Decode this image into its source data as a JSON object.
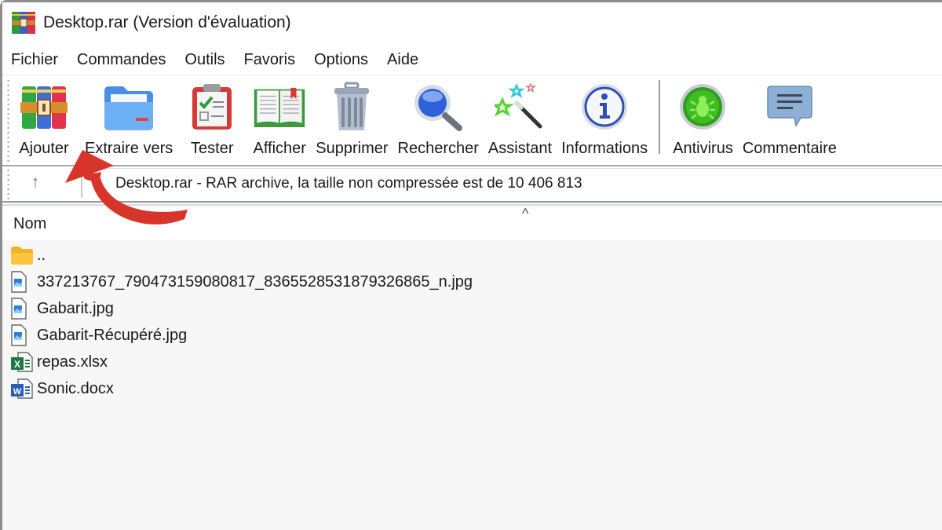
{
  "window": {
    "title": "Desktop.rar (Version d'évaluation)",
    "app_icon": "winrar-books-icon"
  },
  "menu": {
    "items": [
      {
        "label": "Fichier"
      },
      {
        "label": "Commandes"
      },
      {
        "label": "Outils"
      },
      {
        "label": "Favoris"
      },
      {
        "label": "Options"
      },
      {
        "label": "Aide"
      }
    ]
  },
  "toolbar": {
    "buttons": [
      {
        "label": "Ajouter",
        "icon": "add-archive-icon"
      },
      {
        "label": "Extraire vers",
        "icon": "extract-folder-icon"
      },
      {
        "label": "Tester",
        "icon": "test-clipboard-icon"
      },
      {
        "label": "Afficher",
        "icon": "view-book-icon"
      },
      {
        "label": "Supprimer",
        "icon": "trash-icon"
      },
      {
        "label": "Rechercher",
        "icon": "search-magnifier-icon"
      },
      {
        "label": "Assistant",
        "icon": "wizard-wand-icon"
      },
      {
        "label": "Informations",
        "icon": "info-icon"
      },
      {
        "label": "Antivirus",
        "icon": "antivirus-bug-icon"
      },
      {
        "label": "Commentaire",
        "icon": "comment-bubble-icon"
      }
    ]
  },
  "address": {
    "up_icon": "up-arrow-icon",
    "text": "Desktop.rar - RAR archive, la taille non compressée est de 10 406 813"
  },
  "file_list": {
    "column_header": "Nom",
    "sort_indicator": "^",
    "rows": [
      {
        "name": "..",
        "type": "folder"
      },
      {
        "name": "337213767_790473159080817_8365528531879326865_n.jpg",
        "type": "image"
      },
      {
        "name": "Gabarit.jpg",
        "type": "image"
      },
      {
        "name": "Gabarit-Récupéré.jpg",
        "type": "image"
      },
      {
        "name": "repas.xlsx",
        "type": "excel"
      },
      {
        "name": "Sonic.docx",
        "type": "word"
      }
    ]
  },
  "annotation": {
    "arrow_color": "#d8352a",
    "points_to": "Ajouter"
  }
}
